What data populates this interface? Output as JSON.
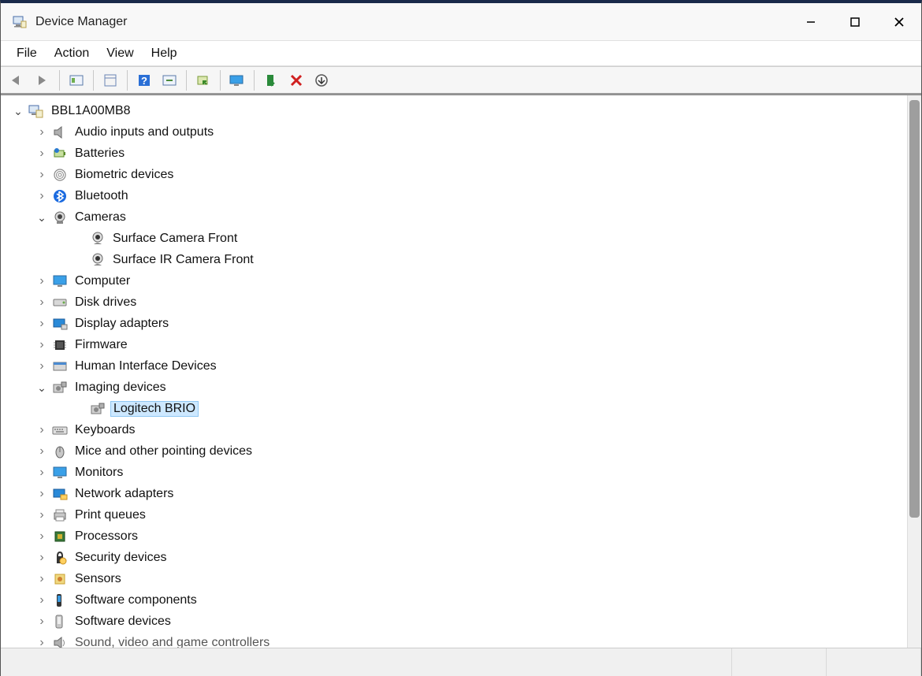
{
  "window": {
    "title": "Device Manager"
  },
  "menu": {
    "file": "File",
    "action": "Action",
    "view": "View",
    "help": "Help"
  },
  "toolbar": {
    "back": "back",
    "forward": "forward",
    "show_hidden": "show-hidden",
    "properties": "properties",
    "help": "help",
    "action": "action",
    "update": "update-driver",
    "monitor": "display",
    "enable": "enable-device",
    "disable": "disable-device",
    "scan": "scan-for-hardware-changes"
  },
  "tree": {
    "root": "BBL1A00MB8",
    "items": [
      {
        "label": "Audio inputs and outputs",
        "icon": "speaker",
        "state": "closed"
      },
      {
        "label": "Batteries",
        "icon": "battery",
        "state": "closed"
      },
      {
        "label": "Biometric devices",
        "icon": "fingerprint",
        "state": "closed"
      },
      {
        "label": "Bluetooth",
        "icon": "bluetooth",
        "state": "closed"
      },
      {
        "label": "Cameras",
        "icon": "camera",
        "state": "open",
        "children": [
          {
            "label": "Surface Camera Front",
            "icon": "webcam"
          },
          {
            "label": "Surface IR Camera Front",
            "icon": "webcam"
          }
        ]
      },
      {
        "label": "Computer",
        "icon": "monitor",
        "state": "closed"
      },
      {
        "label": "Disk drives",
        "icon": "disk",
        "state": "closed"
      },
      {
        "label": "Display adapters",
        "icon": "display-adapter",
        "state": "closed"
      },
      {
        "label": "Firmware",
        "icon": "chip",
        "state": "closed"
      },
      {
        "label": "Human Interface Devices",
        "icon": "hid",
        "state": "closed"
      },
      {
        "label": "Imaging devices",
        "icon": "imaging",
        "state": "open",
        "children": [
          {
            "label": "Logitech BRIO",
            "icon": "imaging",
            "selected": true
          }
        ]
      },
      {
        "label": "Keyboards",
        "icon": "keyboard",
        "state": "closed"
      },
      {
        "label": "Mice and other pointing devices",
        "icon": "mouse",
        "state": "closed"
      },
      {
        "label": "Monitors",
        "icon": "monitor",
        "state": "closed"
      },
      {
        "label": "Network adapters",
        "icon": "network",
        "state": "closed"
      },
      {
        "label": "Print queues",
        "icon": "printer",
        "state": "closed"
      },
      {
        "label": "Processors",
        "icon": "cpu",
        "state": "closed"
      },
      {
        "label": "Security devices",
        "icon": "security",
        "state": "closed"
      },
      {
        "label": "Sensors",
        "icon": "sensor",
        "state": "closed"
      },
      {
        "label": "Software components",
        "icon": "software",
        "state": "closed"
      },
      {
        "label": "Software devices",
        "icon": "software-dev",
        "state": "closed"
      },
      {
        "label": "Sound, video and game controllers",
        "icon": "sound",
        "state": "closed",
        "cut": true
      }
    ]
  }
}
